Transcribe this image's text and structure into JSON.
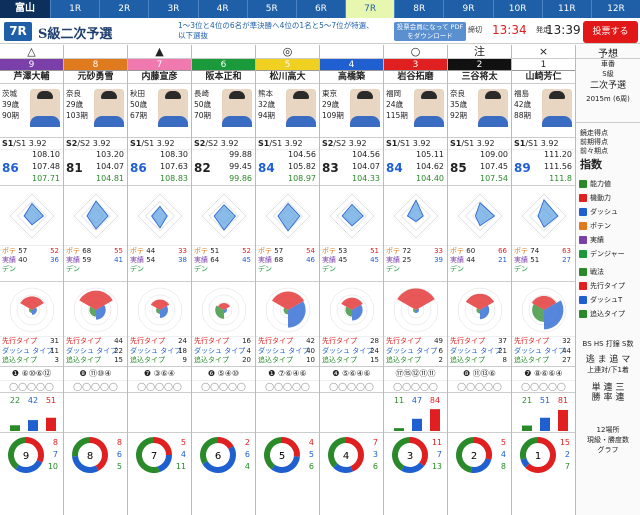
{
  "venue_logo": "富山",
  "tabs": [
    "1R",
    "2R",
    "3R",
    "4R",
    "5R",
    "6R",
    "7R",
    "8R",
    "9R",
    "10R",
    "11R",
    "12R"
  ],
  "active_tab": 6,
  "header": {
    "race_no": "7R",
    "title": "S級二次予選",
    "note": "1～3位と4位の6名が準決勝へ4位の1名と5～7位が特選、以下選抜",
    "pdf": "投票会員になって PDFをダウンロード",
    "deadline_label": "締切",
    "deadline": "13:34",
    "start_label": "発走",
    "start": "13:39",
    "vote": "投票する"
  },
  "racers": [
    {
      "mark": "△",
      "num": "9",
      "color": "#7a3fa8",
      "name": "芦澤大輔",
      "pref": "茨城",
      "age": "39歳",
      "term": "90期",
      "cls": "S1",
      "cls2": "/S1",
      "score": "3.92",
      "pt": "86",
      "v1": "108.10",
      "v2": "107.48",
      "v3": "107.71",
      "radar": [
        57,
        52,
        40,
        36
      ],
      "abil": [
        "57",
        "52",
        "40",
        "36"
      ],
      "tac": [
        "31",
        "11",
        "3"
      ],
      "hist": "❶ ⑥⑩⑥⑫",
      "hist2": "◯◯◯◯◯",
      "bars": [
        "22",
        "42",
        "51"
      ],
      "donut": [
        "8",
        "7",
        "10"
      ]
    },
    {
      "mark": "",
      "num": "8",
      "color": "#e07a1f",
      "name": "元砂勇雪",
      "pref": "奈良",
      "age": "29歳",
      "term": "103期",
      "cls": "S2",
      "cls2": "/S2",
      "score": "3.92",
      "pt": "81",
      "v1": "103.20",
      "v2": "104.07",
      "v3": "104.81",
      "radar": [
        68,
        55,
        59,
        41
      ],
      "abil": [
        "68",
        "55",
        "59",
        "41"
      ],
      "tac": [
        "44",
        "22",
        "15"
      ],
      "hist": "❽ ⑪⑩④",
      "hist2": "◯◯◯◯◯",
      "bars": [
        "",
        "",
        ""
      ],
      "donut": [
        "8",
        "6",
        "5"
      ]
    },
    {
      "mark": "▲",
      "num": "7",
      "color": "#f07ab0",
      "name": "内藤宣彦",
      "pref": "秋田",
      "age": "50歳",
      "term": "67期",
      "cls": "S1",
      "cls2": "/S1",
      "score": "3.92",
      "pt": "86",
      "v1": "108.30",
      "v2": "107.63",
      "v3": "108.83",
      "radar": [
        44,
        33,
        54,
        38
      ],
      "abil": [
        "44",
        "33",
        "54",
        "38"
      ],
      "tac": [
        "24",
        "18",
        "9"
      ],
      "hist": "❼ ③⑥④",
      "hist2": "◯◯◯◯◯",
      "bars": [
        "",
        "",
        ""
      ],
      "donut": [
        "5",
        "4",
        "11"
      ]
    },
    {
      "mark": "",
      "num": "6",
      "color": "#1a9a3a",
      "name": "阪本正和",
      "pref": "長崎",
      "age": "50歳",
      "term": "70期",
      "cls": "S2",
      "cls2": "/S2",
      "score": "3.92",
      "pt": "82",
      "v1": "99.88",
      "v2": "99.45",
      "v3": "99.86",
      "radar": [
        51,
        52,
        64,
        45
      ],
      "abil": [
        "51",
        "52",
        "64",
        "45"
      ],
      "tac": [
        "16",
        "4",
        "20"
      ],
      "hist": "❻ ⑤④⑩",
      "hist2": "◯◯◯◯◯",
      "bars": [
        "",
        "",
        ""
      ],
      "donut": [
        "2",
        "6",
        "4"
      ]
    },
    {
      "mark": "◎",
      "num": "5",
      "color": "#f0d020",
      "name": "松川高大",
      "pref": "熊本",
      "age": "32歳",
      "term": "94期",
      "cls": "S1",
      "cls2": "/S1",
      "score": "3.92",
      "pt": "84",
      "v1": "104.56",
      "v2": "105.82",
      "v3": "108.97",
      "radar": [
        57,
        54,
        68,
        46
      ],
      "abil": [
        "57",
        "54",
        "68",
        "46"
      ],
      "tac": [
        "42",
        "40",
        "10"
      ],
      "hist": "❶ ⑦⑥④⑥",
      "hist2": "◯◯◯◯◯",
      "bars": [
        "",
        "",
        ""
      ],
      "donut": [
        "4",
        "5",
        "6"
      ]
    },
    {
      "mark": "",
      "num": "4",
      "color": "#1f5fd0",
      "name": "高橋築",
      "pref": "東京",
      "age": "29歳",
      "term": "109期",
      "cls": "S2",
      "cls2": "/S2",
      "score": "3.92",
      "pt": "83",
      "v1": "104.56",
      "v2": "104.07",
      "v3": "104.33",
      "radar": [
        53,
        51,
        45,
        45
      ],
      "abil": [
        "53",
        "51",
        "45",
        "45"
      ],
      "tac": [
        "28",
        "24",
        "15"
      ],
      "hist": "❹ ⑤⑥④⑥",
      "hist2": "◯◯◯◯◯",
      "bars": [
        "",
        "",
        ""
      ],
      "donut": [
        "7",
        "3",
        "6"
      ]
    },
    {
      "mark": "○",
      "num": "3",
      "color": "#e02020",
      "name": "岩谷拓磨",
      "pref": "福岡",
      "age": "24歳",
      "term": "115期",
      "cls": "S1",
      "cls2": "/S1",
      "score": "3.92",
      "pt": "84",
      "v1": "105.11",
      "v2": "104.62",
      "v3": "104.40",
      "radar": [
        72,
        33,
        25,
        39
      ],
      "abil": [
        "72",
        "33",
        "25",
        "39"
      ],
      "tac": [
        "49",
        "6",
        "2"
      ],
      "hist": "⑰⑮⑫⑪⑪",
      "hist2": "◯◯◯◯◯",
      "bars": [
        "11",
        "47",
        "84"
      ],
      "donut": [
        "11",
        "7",
        "13"
      ]
    },
    {
      "mark": "注",
      "num": "2",
      "color": "#111",
      "name": "三谷将太",
      "pref": "奈良",
      "age": "35歳",
      "term": "92期",
      "cls": "S1",
      "cls2": "/S1",
      "score": "3.92",
      "pt": "85",
      "v1": "109.00",
      "v2": "107.45",
      "v3": "107.54",
      "radar": [
        60,
        66,
        44,
        21
      ],
      "abil": [
        "60",
        "66",
        "44",
        "21"
      ],
      "tac": [
        "37",
        "21",
        "8"
      ],
      "hist": "❽ ⑪⑬⑥",
      "hist2": "◯◯◯◯◯",
      "bars": [
        "",
        "",
        ""
      ],
      "donut": [
        "5",
        "4",
        "8"
      ]
    },
    {
      "mark": "×",
      "num": "1",
      "color": "#fff",
      "name": "山崎芳仁",
      "pref": "福島",
      "age": "42歳",
      "term": "88期",
      "cls": "S1",
      "cls2": "/S1",
      "score": "3.92",
      "pt": "89",
      "v1": "111.20",
      "v2": "111.56",
      "v3": "111.8",
      "radar": [
        74,
        63,
        51,
        27
      ],
      "abil": [
        "74",
        "63",
        "51",
        "27"
      ],
      "tac": [
        "32",
        "44",
        "27"
      ],
      "hist": "❼ ⑧⑥⑥④",
      "hist2": "◯◯◯◯◯",
      "bars": [
        "21",
        "51",
        "81"
      ],
      "donut": [
        "15",
        "2",
        "7"
      ]
    }
  ],
  "side": {
    "head": "予想",
    "row1": "車番",
    "row2": "S級",
    "grade": "二次予選",
    "dist": "2015m (6周)",
    "hint": "競走得点",
    "a1": "鏡走得点",
    "a2": "前期得点",
    "a3": "前々期点",
    "label_idx": "指数",
    "label_ability": "能力値",
    "leg1": "機動力",
    "leg2": "ダッシュ",
    "leg3": "ポテン",
    "leg4": "実績",
    "leg5": "デンジャー",
    "label_tactic": "戦法",
    "tac1": "先行タイプ",
    "tac2": "ダッシュT",
    "tac3": "追込タイプ",
    "hist_label": "BS HS 打鐘 S数",
    "sub1": "逃 ま 追 マ",
    "sub2": "上連対/下1着",
    "sub3": "単 連 三",
    "sub4": "勝 率 連",
    "place": "12場所",
    "place2": "現級・勝度数",
    "place3": "グラフ"
  },
  "labels": {
    "nobi": "ポテ",
    "kido": "機動",
    "jisseki": "実績",
    "dash": "ダッ",
    "dentaa": "デン",
    "oikomi": "追込",
    "senko": "先行",
    "dashT": "ダッシュ",
    "senko_t": "先行タイプ",
    "dash_t": "ダッシュ タイプ",
    "oikomi_t": "追込タイプ",
    "kyaku": "脚力"
  }
}
